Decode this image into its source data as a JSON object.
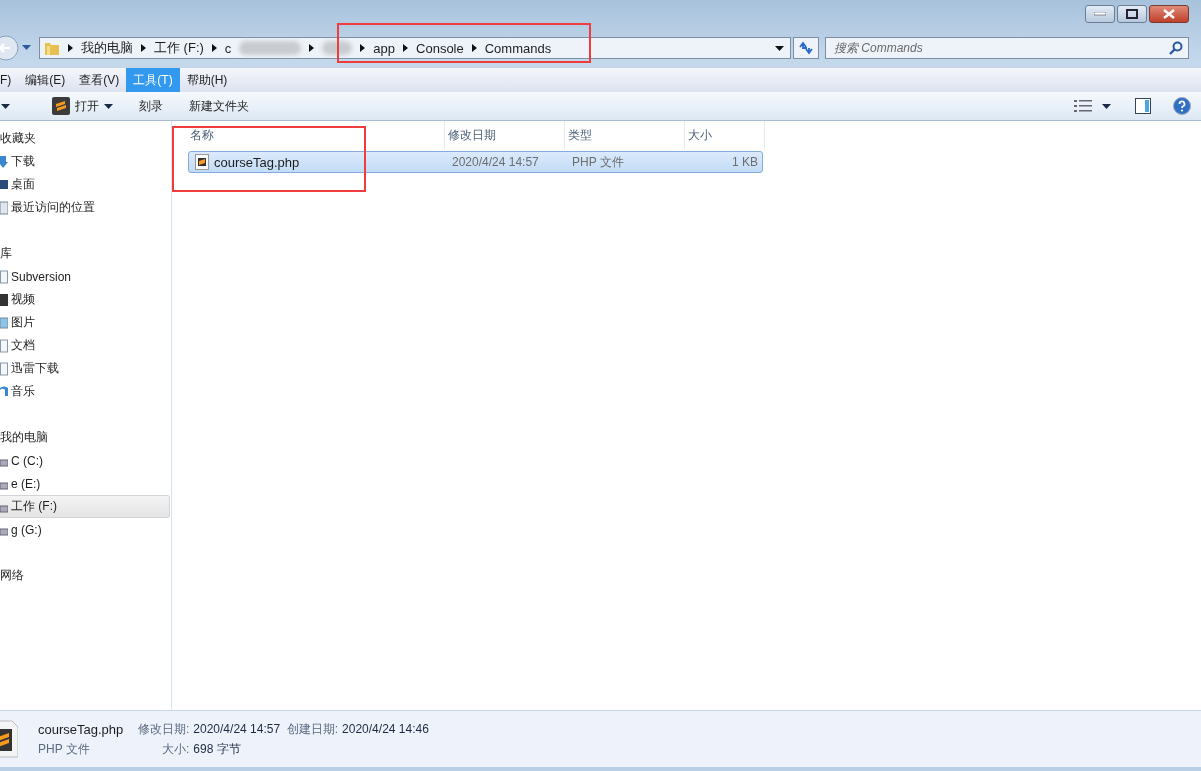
{
  "address_bar": {
    "crumbs": [
      "我的电脑",
      "工作 (F:)",
      "c",
      "app",
      "Console",
      "Commands"
    ]
  },
  "search": {
    "placeholder": "搜索 Commands"
  },
  "menu": [
    {
      "label": "F)",
      "selected": false
    },
    {
      "label": "编辑(E)",
      "selected": false
    },
    {
      "label": "查看(V)",
      "selected": false
    },
    {
      "label": "工具(T)",
      "selected": true
    },
    {
      "label": "帮助(H)",
      "selected": false
    }
  ],
  "toolbar": [
    {
      "label": "打开",
      "kind": "dropdown"
    },
    {
      "label": "刻录",
      "kind": "plain"
    },
    {
      "label": "新建文件夹",
      "kind": "plain"
    }
  ],
  "sidebar": [
    {
      "title": "收藏夹",
      "items": [
        {
          "label": "下载",
          "kind": "download",
          "selected": false
        },
        {
          "label": "桌面",
          "kind": "desktop",
          "selected": false
        },
        {
          "label": "最近访问的位置",
          "kind": "recent",
          "selected": false
        }
      ]
    },
    {
      "title": "库",
      "items": [
        {
          "label": "Subversion",
          "kind": "doc",
          "selected": false
        },
        {
          "label": "视频",
          "kind": "video",
          "selected": false
        },
        {
          "label": "图片",
          "kind": "image",
          "selected": false
        },
        {
          "label": "文档",
          "kind": "doc",
          "selected": false
        },
        {
          "label": "迅雷下载",
          "kind": "doc",
          "selected": false
        },
        {
          "label": "音乐",
          "kind": "music",
          "selected": false
        }
      ]
    },
    {
      "title": "我的电脑",
      "items": [
        {
          "label": "C (C:)",
          "kind": "drive",
          "selected": false
        },
        {
          "label": "e (E:)",
          "kind": "drive",
          "selected": false
        },
        {
          "label": "工作 (F:)",
          "kind": "drive",
          "selected": true
        },
        {
          "label": "g (G:)",
          "kind": "drive",
          "selected": false
        }
      ]
    },
    {
      "title": "网络"
    }
  ],
  "file_list": {
    "columns": [
      "名称",
      "修改日期",
      "类型",
      "大小"
    ],
    "rows": [
      {
        "name": "courseTag.php",
        "modified": "2020/4/24 14:57",
        "type": "PHP 文件",
        "size": "1 KB",
        "selected": true
      }
    ]
  },
  "details_pane": {
    "name": "courseTag.php",
    "type": "PHP 文件",
    "modified_label": "修改日期:",
    "modified": "2020/4/24 14:57",
    "size_label": "大小:",
    "size": "698 字节",
    "created_label": "创建日期:",
    "created": "2020/4/24 14:46"
  }
}
